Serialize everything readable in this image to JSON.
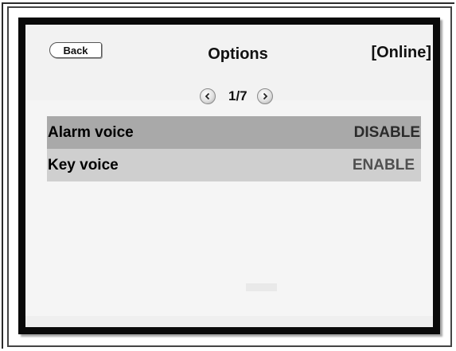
{
  "header": {
    "back_label": "Back",
    "title": "Options",
    "status": "[Online]"
  },
  "pager": {
    "indicator": "1/7",
    "prev_icon": "chevron-left-icon",
    "next_icon": "chevron-right-icon"
  },
  "options": [
    {
      "label": "Alarm voice",
      "value": "DISABLE",
      "selected": true
    },
    {
      "label": "Key voice",
      "value": "ENABLE",
      "selected": false
    }
  ],
  "colors": {
    "selected_row": "#a9a9a9",
    "normal_row": "#cfcfcf",
    "screen_border": "#0a0a0a"
  }
}
